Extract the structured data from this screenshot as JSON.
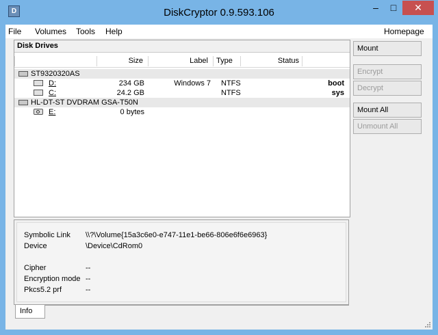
{
  "window": {
    "title": "DiskCryptor 0.9.593.106",
    "minimize_glyph": "–",
    "maximize_glyph": "□",
    "close_glyph": "✕"
  },
  "menu": {
    "items": [
      "File",
      "Volumes",
      "Tools",
      "Help"
    ],
    "homepage": "Homepage"
  },
  "drives_panel": {
    "title": "Disk Drives",
    "columns": [
      "",
      "Size",
      "Label",
      "Type",
      "Status"
    ],
    "rows": [
      {
        "kind": "disk",
        "name": "ST9320320AS",
        "size": "",
        "label": "",
        "type": "",
        "status": ""
      },
      {
        "kind": "volume",
        "name": "D:",
        "size": "234 GB",
        "label": "Windows 7",
        "type": "NTFS",
        "status": "boot"
      },
      {
        "kind": "volume",
        "name": "C:",
        "size": "24.2 GB",
        "label": "",
        "type": "NTFS",
        "status": "sys"
      },
      {
        "kind": "disk",
        "name": "HL-DT-ST DVDRAM GSA-T50N",
        "size": "",
        "label": "",
        "type": "",
        "status": ""
      },
      {
        "kind": "cdrom",
        "name": "E:",
        "size": "0 bytes",
        "label": "",
        "type": "",
        "status": ""
      }
    ]
  },
  "buttons": {
    "mount": "Mount",
    "encrypt": "Encrypt",
    "decrypt": "Decrypt",
    "mount_all": "Mount All",
    "unmount_all": "Unmount All"
  },
  "info": {
    "symbolic_link_label": "Symbolic Link",
    "symbolic_link_value": "\\\\?\\Volume{15a3c6e0-e747-11e1-be66-806e6f6e6963}",
    "device_label": "Device",
    "device_value": "\\Device\\CdRom0",
    "cipher_label": "Cipher",
    "cipher_value": "--",
    "encryption_mode_label": "Encryption mode",
    "encryption_mode_value": "--",
    "pkcs_label": "Pkcs5.2 prf",
    "pkcs_value": "--"
  },
  "tabs": {
    "info": "Info"
  },
  "colors": {
    "frame": "#78b4e6",
    "close_button": "#c75050",
    "disabled_text": "#9a9a9a"
  }
}
